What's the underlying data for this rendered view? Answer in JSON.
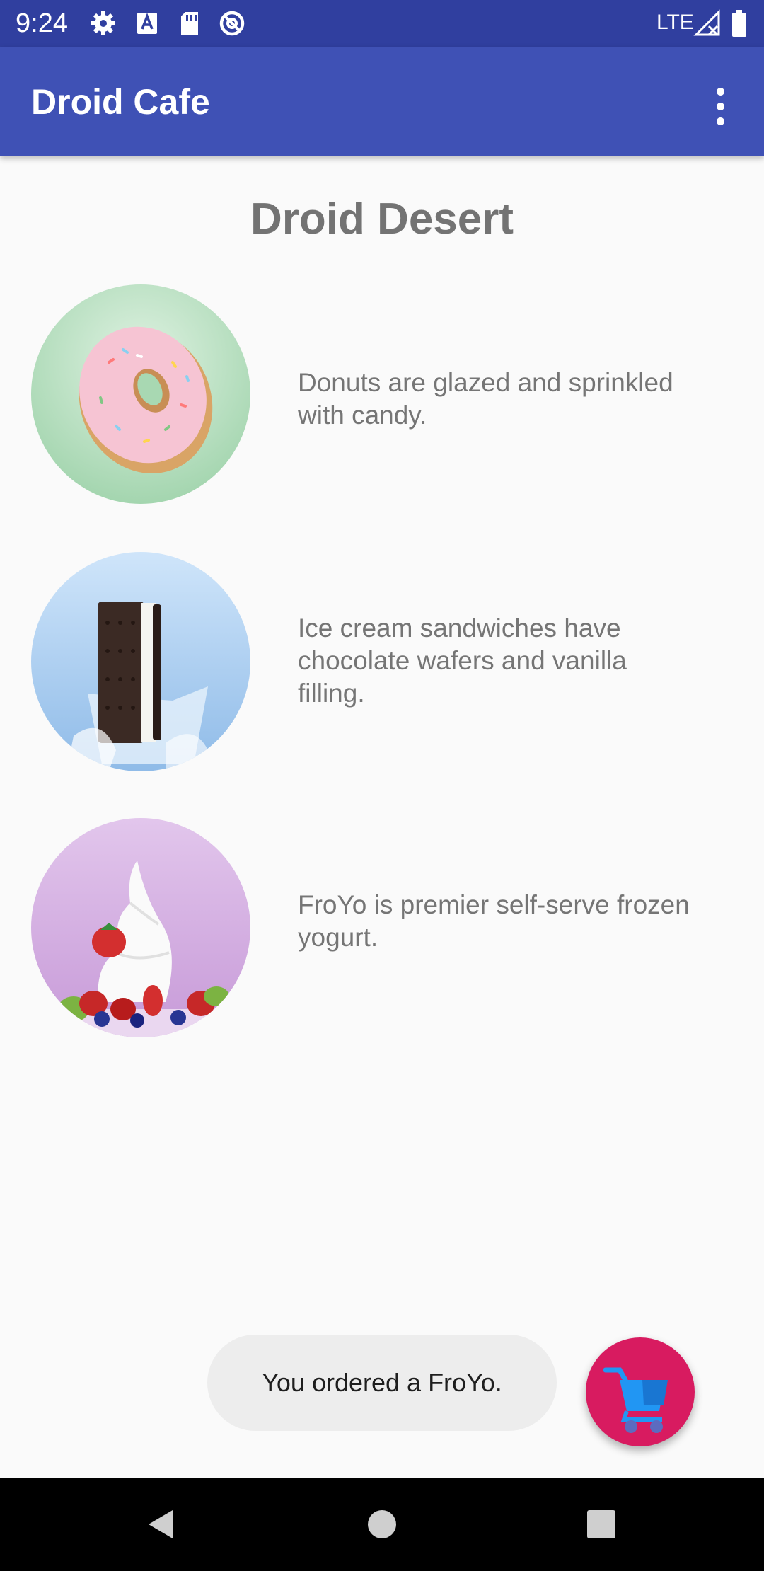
{
  "status_bar": {
    "time": "9:24",
    "network": "LTE",
    "icons": [
      "settings-icon",
      "font-a-icon",
      "sd-card-icon",
      "no-disturb-icon",
      "signal-icon",
      "battery-icon"
    ]
  },
  "app_bar": {
    "title": "Droid Cafe",
    "menu_icon": "more-vert-icon"
  },
  "content": {
    "heading": "Droid Desert",
    "items": [
      {
        "image": "donut-image",
        "description": "Donuts are glazed and sprinkled with candy."
      },
      {
        "image": "ice-cream-sandwich-image",
        "description": "Ice cream sandwiches have chocolate wafers and vanilla filling."
      },
      {
        "image": "froyo-image",
        "description": "FroYo is premier self-serve frozen yogurt."
      }
    ]
  },
  "toast": {
    "message": "You ordered a FroYo."
  },
  "fab": {
    "icon": "shopping-cart-icon"
  },
  "nav_bar": {
    "buttons": [
      "back-icon",
      "home-icon",
      "recents-icon"
    ]
  },
  "colors": {
    "status_bar": "#303f9f",
    "app_bar": "#3f51b5",
    "fab": "#d81b60",
    "cart": "#2196f3"
  }
}
